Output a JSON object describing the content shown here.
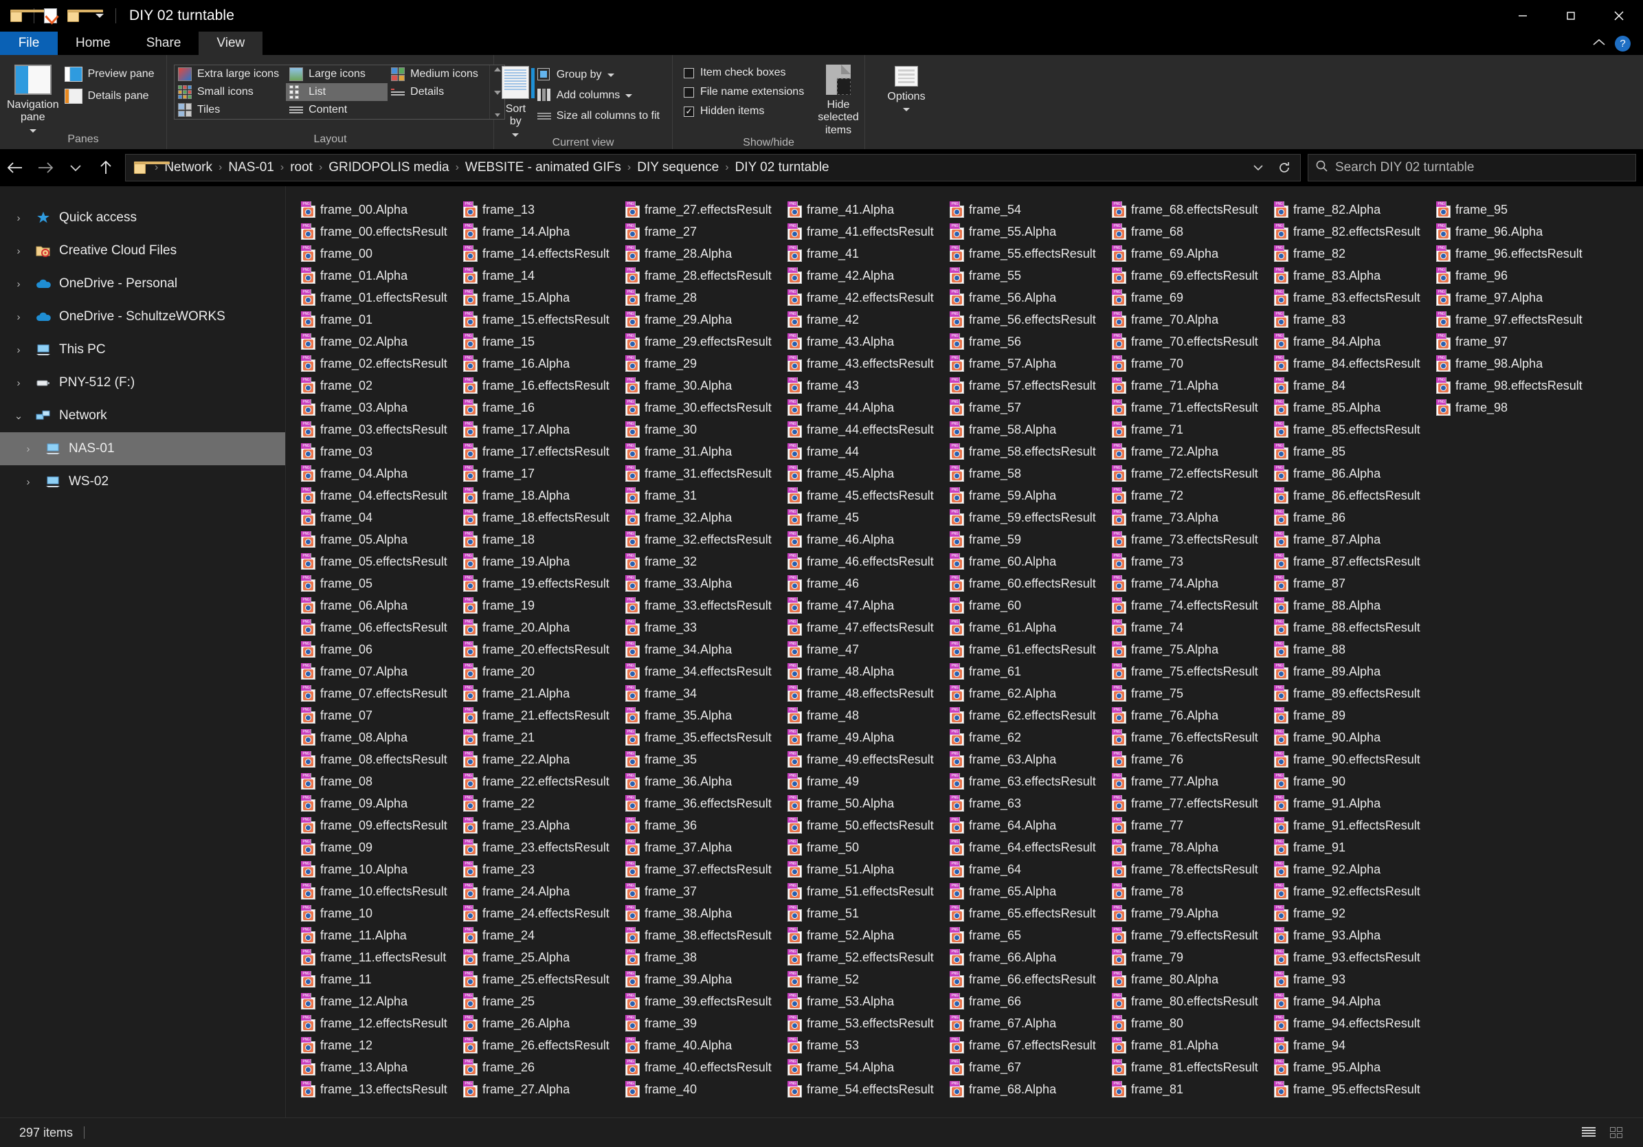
{
  "window": {
    "title": "DIY 02 turntable",
    "quick_access_icons": [
      "folder-icon",
      "properties-icon",
      "new-folder-icon",
      "customize-caret-icon"
    ],
    "controls": {
      "minimize": "minimize-icon",
      "maximize": "maximize-icon",
      "close": "close-icon"
    }
  },
  "ribbon": {
    "tabs": [
      {
        "label": "File",
        "state": "file"
      },
      {
        "label": "Home",
        "state": "normal"
      },
      {
        "label": "Share",
        "state": "normal"
      },
      {
        "label": "View",
        "state": "active"
      }
    ],
    "collapse_label": "⌃",
    "help_label": "?",
    "groups": {
      "panes": {
        "title": "Panes",
        "navigation_pane": "Navigation\npane",
        "preview_pane": "Preview pane",
        "details_pane": "Details pane"
      },
      "layout": {
        "title": "Layout",
        "items": [
          "Extra large icons",
          "Large icons",
          "Medium icons",
          "Small icons",
          "List",
          "Details",
          "Tiles",
          "Content"
        ],
        "selected": "List"
      },
      "current_view": {
        "title": "Current view",
        "sort_by": "Sort\nby",
        "group_by": "Group by",
        "add_columns": "Add columns",
        "size_all_columns": "Size all columns to fit"
      },
      "show_hide": {
        "title": "Show/hide",
        "item_check_boxes": {
          "label": "Item check boxes",
          "checked": false
        },
        "file_name_extensions": {
          "label": "File name extensions",
          "checked": false
        },
        "hidden_items": {
          "label": "Hidden items",
          "checked": true
        },
        "hide_selected_items": "Hide selected\nitems"
      },
      "options": {
        "label": "Options"
      }
    }
  },
  "address_bar": {
    "back": "back-arrow",
    "forward": "forward-arrow",
    "recent": "recent-caret",
    "up": "up-arrow",
    "crumbs": [
      "Network",
      "NAS-01",
      "root",
      "GRIDOPOLIS media",
      "WEBSITE - animated GIFs",
      "DIY sequence",
      "DIY 02 turntable"
    ],
    "separator": "›",
    "dropdown": "⌄",
    "refresh": "↻",
    "search_placeholder": "Search DIY 02 turntable"
  },
  "sidebar": {
    "items": [
      {
        "label": "Quick access",
        "icon": "star-pin-icon",
        "expanded": false,
        "indent": 0,
        "selected": false
      },
      {
        "label": "Creative Cloud Files",
        "icon": "creative-cloud-folder-icon",
        "expanded": false,
        "indent": 0,
        "selected": false
      },
      {
        "label": "OneDrive - Personal",
        "icon": "onedrive-cloud-icon",
        "expanded": false,
        "indent": 0,
        "selected": false
      },
      {
        "label": "OneDrive - SchultzeWORKS",
        "icon": "onedrive-cloud-icon",
        "expanded": false,
        "indent": 0,
        "selected": false
      },
      {
        "label": "This PC",
        "icon": "this-pc-icon",
        "expanded": false,
        "indent": 0,
        "selected": false
      },
      {
        "label": "PNY-512 (F:)",
        "icon": "usb-drive-icon",
        "expanded": false,
        "indent": 0,
        "selected": false
      },
      {
        "label": "Network",
        "icon": "network-icon",
        "expanded": true,
        "indent": 0,
        "selected": false
      },
      {
        "label": "NAS-01",
        "icon": "computer-icon",
        "expanded": false,
        "indent": 1,
        "selected": true
      },
      {
        "label": "WS-02",
        "icon": "computer-icon",
        "expanded": false,
        "indent": 1,
        "selected": false
      }
    ]
  },
  "files": {
    "icon": "png-file-icon",
    "columns": [
      [
        "frame_00.Alpha",
        "frame_00.effectsResult",
        "frame_00",
        "frame_01.Alpha",
        "frame_01.effectsResult",
        "frame_01",
        "frame_02.Alpha",
        "frame_02.effectsResult",
        "frame_02",
        "frame_03.Alpha",
        "frame_03.effectsResult",
        "frame_03",
        "frame_04.Alpha",
        "frame_04.effectsResult",
        "frame_04",
        "frame_05.Alpha",
        "frame_05.effectsResult",
        "frame_05",
        "frame_06.Alpha",
        "frame_06.effectsResult",
        "frame_06",
        "frame_07.Alpha",
        "frame_07.effectsResult",
        "frame_07",
        "frame_08.Alpha",
        "frame_08.effectsResult",
        "frame_08",
        "frame_09.Alpha",
        "frame_09.effectsResult",
        "frame_09",
        "frame_10.Alpha",
        "frame_10.effectsResult",
        "frame_10",
        "frame_11.Alpha",
        "frame_11.effectsResult",
        "frame_11",
        "frame_12.Alpha",
        "frame_12.effectsResult",
        "frame_12",
        "frame_13.Alpha",
        "frame_13.effectsResult",
        "frame_13"
      ],
      [
        "frame_14.Alpha",
        "frame_14.effectsResult",
        "frame_14",
        "frame_15.Alpha",
        "frame_15.effectsResult",
        "frame_15",
        "frame_16.Alpha",
        "frame_16.effectsResult",
        "frame_16",
        "frame_17.Alpha",
        "frame_17.effectsResult",
        "frame_17",
        "frame_18.Alpha",
        "frame_18.effectsResult",
        "frame_18",
        "frame_19.Alpha",
        "frame_19.effectsResult",
        "frame_19",
        "frame_20.Alpha",
        "frame_20.effectsResult",
        "frame_20",
        "frame_21.Alpha",
        "frame_21.effectsResult",
        "frame_21",
        "frame_22.Alpha",
        "frame_22.effectsResult",
        "frame_22",
        "frame_23.Alpha",
        "frame_23.effectsResult",
        "frame_23",
        "frame_24.Alpha",
        "frame_24.effectsResult",
        "frame_24",
        "frame_25.Alpha",
        "frame_25.effectsResult",
        "frame_25",
        "frame_26.Alpha",
        "frame_26.effectsResult",
        "frame_26",
        "frame_27.Alpha",
        "frame_27.effectsResult",
        "frame_27"
      ],
      [
        "frame_28.Alpha",
        "frame_28.effectsResult",
        "frame_28",
        "frame_29.Alpha",
        "frame_29.effectsResult",
        "frame_29",
        "frame_30.Alpha",
        "frame_30.effectsResult",
        "frame_30",
        "frame_31.Alpha",
        "frame_31.effectsResult",
        "frame_31",
        "frame_32.Alpha",
        "frame_32.effectsResult",
        "frame_32",
        "frame_33.Alpha",
        "frame_33.effectsResult",
        "frame_33",
        "frame_34.Alpha",
        "frame_34.effectsResult",
        "frame_34",
        "frame_35.Alpha",
        "frame_35.effectsResult",
        "frame_35",
        "frame_36.Alpha",
        "frame_36.effectsResult",
        "frame_36",
        "frame_37.Alpha",
        "frame_37.effectsResult",
        "frame_37",
        "frame_38.Alpha",
        "frame_38.effectsResult",
        "frame_38",
        "frame_39.Alpha",
        "frame_39.effectsResult",
        "frame_39",
        "frame_40.Alpha",
        "frame_40.effectsResult",
        "frame_40",
        "frame_41.Alpha",
        "frame_41.effectsResult",
        "frame_41"
      ],
      [
        "frame_42.Alpha",
        "frame_42.effectsResult",
        "frame_42",
        "frame_43.Alpha",
        "frame_43.effectsResult",
        "frame_43",
        "frame_44.Alpha",
        "frame_44.effectsResult",
        "frame_44",
        "frame_45.Alpha",
        "frame_45.effectsResult",
        "frame_45",
        "frame_46.Alpha",
        "frame_46.effectsResult",
        "frame_46",
        "frame_47.Alpha",
        "frame_47.effectsResult",
        "frame_47",
        "frame_48.Alpha",
        "frame_48.effectsResult",
        "frame_48",
        "frame_49.Alpha",
        "frame_49.effectsResult",
        "frame_49",
        "frame_50.Alpha",
        "frame_50.effectsResult",
        "frame_50",
        "frame_51.Alpha",
        "frame_51.effectsResult",
        "frame_51",
        "frame_52.Alpha",
        "frame_52.effectsResult",
        "frame_52",
        "frame_53.Alpha",
        "frame_53.effectsResult",
        "frame_53",
        "frame_54.Alpha",
        "frame_54.effectsResult",
        "frame_54",
        "frame_55.Alpha",
        "frame_55.effectsResult",
        "frame_55"
      ],
      [
        "frame_56.Alpha",
        "frame_56.effectsResult",
        "frame_56",
        "frame_57.Alpha",
        "frame_57.effectsResult",
        "frame_57",
        "frame_58.Alpha",
        "frame_58.effectsResult",
        "frame_58",
        "frame_59.Alpha",
        "frame_59.effectsResult",
        "frame_59",
        "frame_60.Alpha",
        "frame_60.effectsResult",
        "frame_60",
        "frame_61.Alpha",
        "frame_61.effectsResult",
        "frame_61",
        "frame_62.Alpha",
        "frame_62.effectsResult",
        "frame_62",
        "frame_63.Alpha",
        "frame_63.effectsResult",
        "frame_63",
        "frame_64.Alpha",
        "frame_64.effectsResult",
        "frame_64",
        "frame_65.Alpha",
        "frame_65.effectsResult",
        "frame_65",
        "frame_66.Alpha",
        "frame_66.effectsResult",
        "frame_66",
        "frame_67.Alpha",
        "frame_67.effectsResult",
        "frame_67",
        "frame_68.Alpha",
        "frame_68.effectsResult",
        "frame_68",
        "frame_69.Alpha",
        "frame_69.effectsResult",
        "frame_69"
      ],
      [
        "frame_70.Alpha",
        "frame_70.effectsResult",
        "frame_70",
        "frame_71.Alpha",
        "frame_71.effectsResult",
        "frame_71",
        "frame_72.Alpha",
        "frame_72.effectsResult",
        "frame_72",
        "frame_73.Alpha",
        "frame_73.effectsResult",
        "frame_73",
        "frame_74.Alpha",
        "frame_74.effectsResult",
        "frame_74",
        "frame_75.Alpha",
        "frame_75.effectsResult",
        "frame_75",
        "frame_76.Alpha",
        "frame_76.effectsResult",
        "frame_76",
        "frame_77.Alpha",
        "frame_77.effectsResult",
        "frame_77",
        "frame_78.Alpha",
        "frame_78.effectsResult",
        "frame_78",
        "frame_79.Alpha",
        "frame_79.effectsResult",
        "frame_79",
        "frame_80.Alpha",
        "frame_80.effectsResult",
        "frame_80",
        "frame_81.Alpha",
        "frame_81.effectsResult",
        "frame_81",
        "frame_82.Alpha",
        "frame_82.effectsResult",
        "frame_82",
        "frame_83.Alpha",
        "frame_83.effectsResult",
        "frame_83"
      ],
      [
        "frame_84.Alpha",
        "frame_84.effectsResult",
        "frame_84",
        "frame_85.Alpha",
        "frame_85.effectsResult",
        "frame_85",
        "frame_86.Alpha",
        "frame_86.effectsResult",
        "frame_86",
        "frame_87.Alpha",
        "frame_87.effectsResult",
        "frame_87",
        "frame_88.Alpha",
        "frame_88.effectsResult",
        "frame_88",
        "frame_89.Alpha",
        "frame_89.effectsResult",
        "frame_89",
        "frame_90.Alpha",
        "frame_90.effectsResult",
        "frame_90",
        "frame_91.Alpha",
        "frame_91.effectsResult",
        "frame_91",
        "frame_92.Alpha",
        "frame_92.effectsResult",
        "frame_92",
        "frame_93.Alpha",
        "frame_93.effectsResult",
        "frame_93",
        "frame_94.Alpha",
        "frame_94.effectsResult",
        "frame_94",
        "frame_95.Alpha",
        "frame_95.effectsResult",
        "frame_95",
        "frame_96.Alpha",
        "frame_96.effectsResult",
        "frame_96",
        "frame_97.Alpha",
        "frame_97.effectsResult",
        "frame_97"
      ],
      [
        "frame_98.Alpha",
        "frame_98.effectsResult",
        "frame_98"
      ]
    ]
  },
  "status": {
    "item_count": "297 items",
    "view_details": "details-view-icon",
    "view_large": "large-icons-view-icon"
  },
  "colors": {
    "accent": "#0a61b5",
    "selection": "#6d6d6d",
    "background": "#1e1e1e",
    "chrome": "#000000",
    "ribbon": "#2b2b2b"
  }
}
